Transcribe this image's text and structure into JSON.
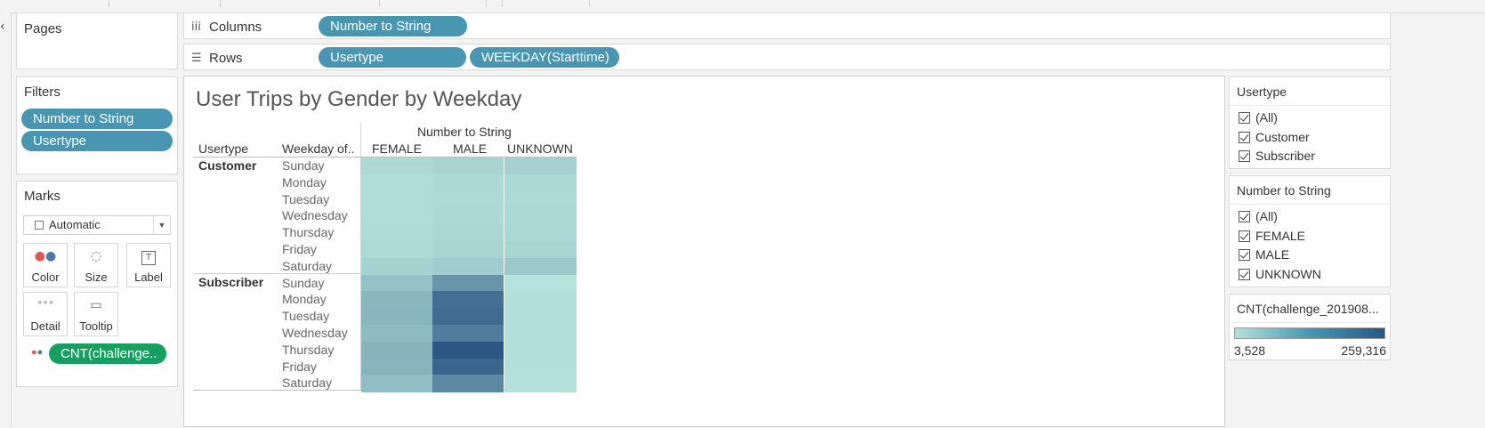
{
  "shelves": {
    "pages_label": "Pages",
    "columns_label": "Columns",
    "rows_label": "Rows",
    "columns_pills": [
      "Number to String"
    ],
    "rows_pills": [
      "Usertype",
      "WEEKDAY(Starttime)"
    ]
  },
  "filters": {
    "title": "Filters",
    "pills": [
      "Number to String",
      "Usertype"
    ]
  },
  "marks": {
    "title": "Marks",
    "type_select": "Automatic",
    "buttons": [
      {
        "label": "Color",
        "icon": "color-dots-icon"
      },
      {
        "label": "Size",
        "icon": "size-shapes-icon"
      },
      {
        "label": "Label",
        "icon": "label-text-icon"
      },
      {
        "label": "Detail",
        "icon": "detail-dots-icon"
      },
      {
        "label": "Tooltip",
        "icon": "tooltip-bubble-icon"
      }
    ],
    "field_pill": "CNT(challenge.."
  },
  "view": {
    "title": "User Trips by Gender by Weekday",
    "column_header_title": "Number to String",
    "row_header_1": "Usertype",
    "row_header_2": "Weekday of..",
    "columns": [
      "FEMALE",
      "MALE",
      "UNKNOWN"
    ],
    "groups": [
      {
        "name": "Customer",
        "days": [
          "Sunday",
          "Monday",
          "Tuesday",
          "Wednesday",
          "Thursday",
          "Friday",
          "Saturday"
        ]
      },
      {
        "name": "Subscriber",
        "days": [
          "Sunday",
          "Monday",
          "Tuesday",
          "Wednesday",
          "Thursday",
          "Friday",
          "Saturday"
        ]
      }
    ]
  },
  "chart_data": {
    "type": "heatmap",
    "title": "User Trips by Gender by Weekday",
    "x_field": "Number to String",
    "y_fields": [
      "Usertype",
      "Weekday of.."
    ],
    "columns": [
      "FEMALE",
      "MALE",
      "UNKNOWN"
    ],
    "rows": [
      {
        "usertype": "Customer",
        "weekday": "Sunday",
        "values": [
          12000,
          18000,
          22000
        ]
      },
      {
        "usertype": "Customer",
        "weekday": "Monday",
        "values": [
          8000,
          12000,
          12000
        ]
      },
      {
        "usertype": "Customer",
        "weekday": "Tuesday",
        "values": [
          8000,
          11000,
          11000
        ]
      },
      {
        "usertype": "Customer",
        "weekday": "Wednesday",
        "values": [
          8000,
          12000,
          12000
        ]
      },
      {
        "usertype": "Customer",
        "weekday": "Thursday",
        "values": [
          9000,
          14000,
          13000
        ]
      },
      {
        "usertype": "Customer",
        "weekday": "Friday",
        "values": [
          11000,
          17000,
          17000
        ]
      },
      {
        "usertype": "Customer",
        "weekday": "Saturday",
        "values": [
          20000,
          28000,
          34000
        ]
      },
      {
        "usertype": "Subscriber",
        "weekday": "Sunday",
        "values": [
          45000,
          125000,
          3528
        ]
      },
      {
        "usertype": "Subscriber",
        "weekday": "Monday",
        "values": [
          62000,
          205000,
          4500
        ]
      },
      {
        "usertype": "Subscriber",
        "weekday": "Tuesday",
        "values": [
          65000,
          215000,
          4500
        ]
      },
      {
        "usertype": "Subscriber",
        "weekday": "Wednesday",
        "values": [
          55000,
          175000,
          4500
        ]
      },
      {
        "usertype": "Subscriber",
        "weekday": "Thursday",
        "values": [
          70000,
          259316,
          5000
        ]
      },
      {
        "usertype": "Subscriber",
        "weekday": "Friday",
        "values": [
          67000,
          225000,
          4800
        ]
      },
      {
        "usertype": "Subscriber",
        "weekday": "Saturday",
        "values": [
          50000,
          150000,
          4000
        ]
      }
    ],
    "color_range": [
      3528,
      259316
    ],
    "color_low": "#b5e2da",
    "color_high": "#2a5783"
  },
  "legends": {
    "usertype": {
      "title": "Usertype",
      "items": [
        "(All)",
        "Customer",
        "Subscriber"
      ]
    },
    "gender": {
      "title": "Number to String",
      "items": [
        "(All)",
        "FEMALE",
        "MALE",
        "UNKNOWN"
      ]
    },
    "color": {
      "title": "CNT(challenge_201908...",
      "min_label": "3,528",
      "max_label": "259,316"
    }
  }
}
